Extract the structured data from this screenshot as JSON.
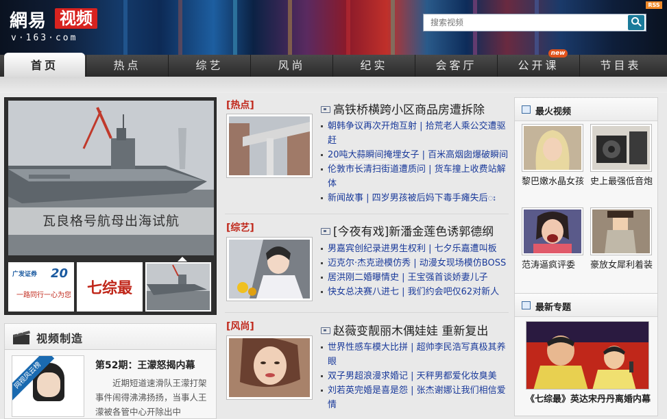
{
  "header": {
    "logo_line1": "網易",
    "logo_line1b": "视频",
    "logo_line2": "v·163·com",
    "rss": "RSS",
    "search_placeholder": "搜索视频"
  },
  "nav": {
    "tabs": [
      "首页",
      "热点",
      "综艺",
      "风尚",
      "纪实",
      "会客厅",
      "公开课",
      "节目表"
    ],
    "new_badge": "new"
  },
  "focus": {
    "caption": "瓦良格号航母出海试航",
    "thumb1_brand": "广发证券",
    "thumb1_tag": "20",
    "thumb1_slogan": "一路同行一心为您",
    "thumb2_text": "七综最"
  },
  "maker": {
    "title": "视频制造",
    "badge": "网视风云榜",
    "headline": "第52期：王濛怒揭内幕",
    "desc": "近期短道速滑队王濛打架事件闹得沸沸扬扬，当事人王濛被各管中心开除出中"
  },
  "sections": [
    {
      "tag": "[热点]",
      "headline": "高铁桥横跨小区商品房遭拆除",
      "links": [
        "朝韩争议再次开炮互射 | 拾荒老人乘公交遭驱赶",
        "20吨大蒜瞬间掩埋女子 | 百米高烟囱爆破瞬间",
        "伦敦市长清扫街道遭质问 | 货车撞上收费站解体",
        "新闻故事 | 四岁男孩被后妈下毒手瘫失后း"
      ]
    },
    {
      "tag": "[综艺]",
      "headline": "[今夜有戏]新潘金莲色诱郭德纲",
      "links": [
        "男嘉宾创纪录进男生权利 | 七夕乐嘉遭叫板",
        "迈克尔·杰克逊模仿秀 | 动漫女现场模仿BOSS",
        "居洪刚二婚曝情史 | 王宝强首谈娇妻儿子",
        "快女总决赛八进七 | 我们约会吧仅62对新人"
      ]
    },
    {
      "tag": "[风尚]",
      "headline": "赵薇变靓丽木偶娃娃 重新复出",
      "links": [
        "世界性感车模大比拼 | 超帅李民浩写真极其养眼",
        "双子男超浪漫求婚记 | 天秤男都爱化妆臭美",
        "刘若英完婚是喜是怨 | 张杰谢娜让我们相信爱情"
      ]
    }
  ],
  "hot_videos": {
    "title": "最火视频",
    "items": [
      "黎巴嫩水晶女孩",
      "史上最强低音炮",
      "范涛逼疯评委",
      "豪放女犀利着装"
    ]
  },
  "topics": {
    "title": "最新专题",
    "caption": "《七综最》英达宋丹丹离婚内幕"
  }
}
